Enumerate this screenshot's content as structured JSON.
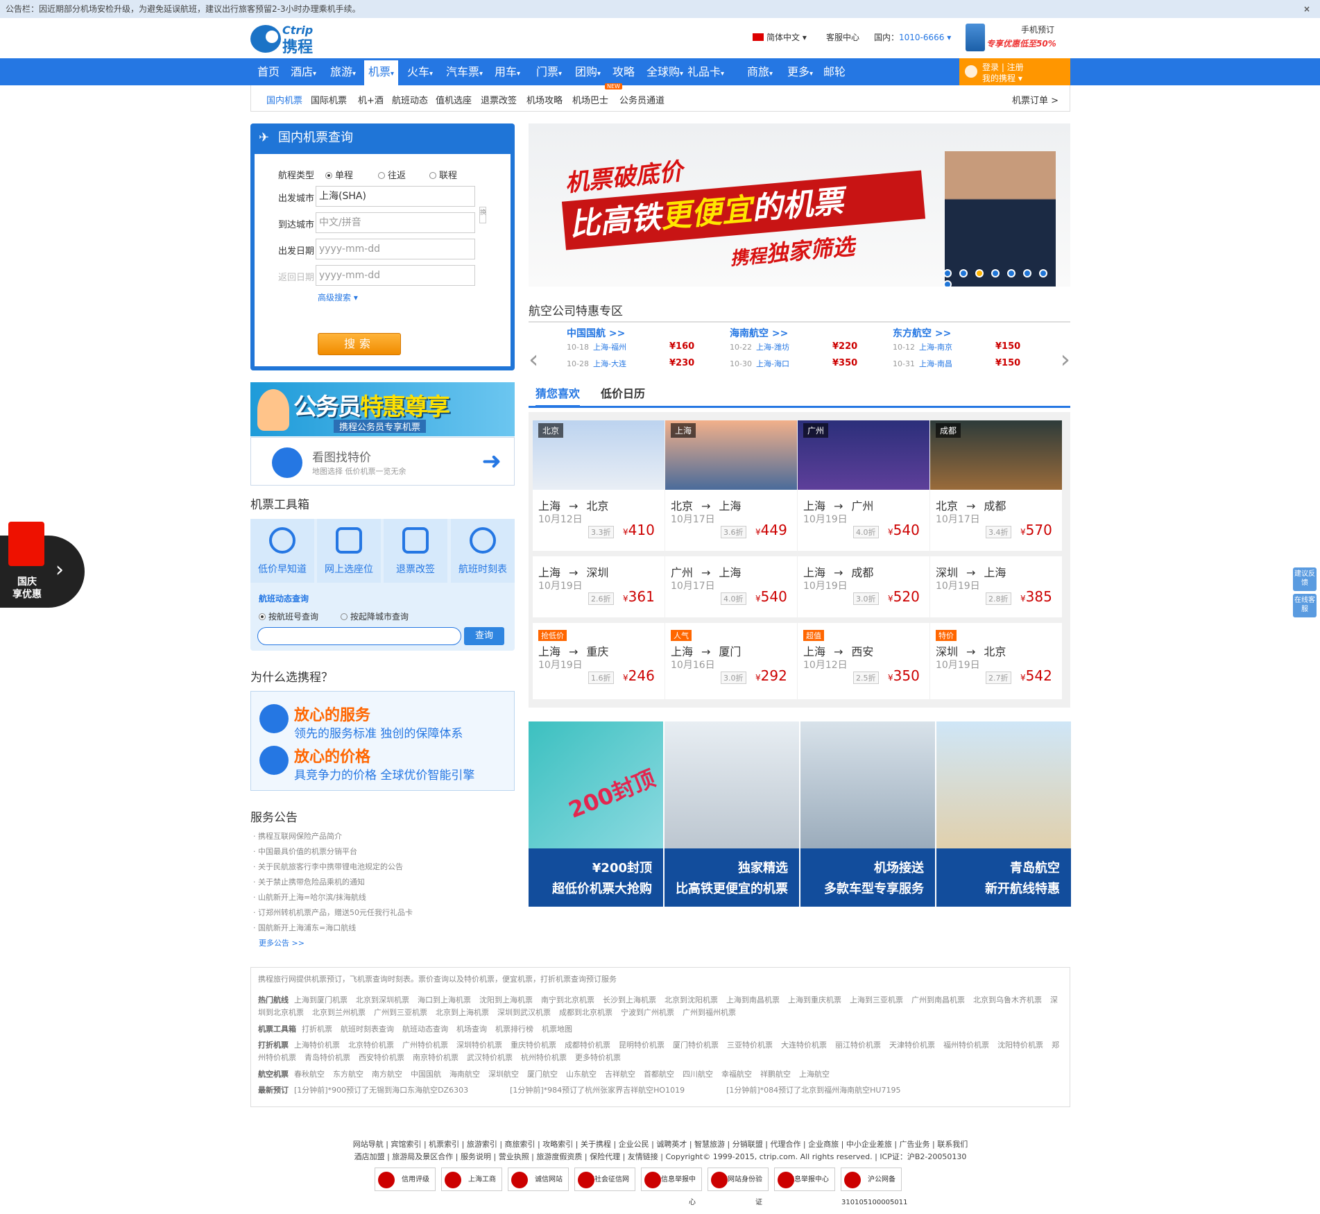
{
  "notice": {
    "text": "公告栏：因近期部分机场安检升级，为避免延误航班，建议出行旅客预留2-3小时办理乘机手续。",
    "close": "×"
  },
  "logo": {
    "en": "Ctrip",
    "cn": "携程"
  },
  "top": {
    "lang": "简体中文 ▾",
    "service": "客服中心",
    "phone_label": "国内：",
    "phone": "1010-6666 ▾",
    "mobile_title": "手机预订",
    "mobile_promo": "专享优惠低至50%"
  },
  "nav": {
    "items": [
      "首页",
      "酒店",
      "旅游",
      "机票",
      "火车",
      "汽车票",
      "用车",
      "门票",
      "团购",
      "攻略",
      "全球购",
      "礼品卡",
      "商旅",
      "更多",
      "邮轮"
    ],
    "carets": [
      "",
      "▾",
      "▾",
      "▾",
      "▾",
      "▾",
      "▾",
      "▾",
      "▾",
      "",
      "▾",
      "▾",
      "▾",
      "▾",
      ""
    ],
    "login": "登录 | 注册",
    "mytrip": "我的携程 ▾"
  },
  "subnav": {
    "items": [
      "国内机票",
      "国际机票",
      "机+酒",
      "航班动态",
      "值机选座",
      "退票改签",
      "机场攻略",
      "机场巴士",
      "公务员通道"
    ],
    "new_tag": "NEW",
    "orders": "机票订单 >"
  },
  "search": {
    "title": "国内机票查询",
    "type_label": "航程类型",
    "types": [
      "单程",
      "往返",
      "联程"
    ],
    "from_label": "出发城市",
    "from_value": "上海(SHA)",
    "to_label": "到达城市",
    "to_placeholder": "中文/拼音",
    "date_label": "出发日期",
    "date_placeholder": "yyyy-mm-dd",
    "return_label": "返回日期",
    "return_placeholder": "yyyy-mm-dd",
    "advanced": "高级搜索 ▾",
    "button": "搜索",
    "swap": "换"
  },
  "banner_civil": {
    "title1": "公务员",
    "title2": "特惠尊享",
    "sub": "携程公务员专享机票"
  },
  "mapfind": {
    "title": "看图找特价",
    "sub": "地图选择  低价机票一览无余"
  },
  "toolbox": {
    "title": "机票工具箱",
    "tools": [
      "低价早知道",
      "网上选座位",
      "退票改签",
      "航班时刻表"
    ],
    "flight_title": "航班动态查询",
    "opt1": "按航班号查询",
    "opt2": "按起降城市查询",
    "query": "查询"
  },
  "why": {
    "title": "为什么选携程？",
    "items": [
      {
        "h": "放心的服务",
        "d": "领先的服务标准 独创的保障体系"
      },
      {
        "h": "放心的价格",
        "d": "具竞争力的价格 全球优价智能引擎"
      }
    ]
  },
  "service": {
    "title": "服务公告",
    "items": [
      "· 携程互联网保险产品简介",
      "· 中国最具价值的机票分销平台",
      "· 关于民航旅客行李中携带锂电池规定的公告",
      "· 关于禁止携带危险品乘机的通知",
      "· 山航新开上海=哈尔滨/抹海航线",
      "· 订郑州转机机票产品，赠送50元任我行礼品卡",
      "· 国航新开上海浦东=海口航线"
    ],
    "more": "更多公告 >>"
  },
  "carousel": {
    "t1": "机票破底价",
    "t2a": "比高铁",
    "t2b": "更便宜",
    "t2c": "的机票",
    "t3a": "携程",
    "t3b": "独家筛选",
    "dots": 8,
    "active": 2
  },
  "airlines": {
    "title": "航空公司特惠专区",
    "list": [
      {
        "name": "中国国航 >>",
        "routes": [
          {
            "d": "10-18",
            "r": "上海-福州",
            "p": "¥160"
          },
          {
            "d": "10-28",
            "r": "上海-大连",
            "p": "¥230"
          }
        ]
      },
      {
        "name": "海南航空 >>",
        "routes": [
          {
            "d": "10-22",
            "r": "上海-潍坊",
            "p": "¥220"
          },
          {
            "d": "10-30",
            "r": "上海-海口",
            "p": "¥350"
          }
        ]
      },
      {
        "name": "东方航空 >>",
        "routes": [
          {
            "d": "10-12",
            "r": "上海-南京",
            "p": "¥150"
          },
          {
            "d": "10-31",
            "r": "上海-南昌",
            "p": "¥150"
          }
        ]
      }
    ]
  },
  "tabs": [
    "猜您喜欢",
    "低价日历"
  ],
  "cards": [
    {
      "city": "北京",
      "from": "上海",
      "to": "北京",
      "date": "10月12日",
      "disc": "3.3折",
      "price": "410",
      "tag": ""
    },
    {
      "city": "上海",
      "from": "北京",
      "to": "上海",
      "date": "10月17日",
      "disc": "3.6折",
      "price": "449",
      "tag": ""
    },
    {
      "city": "广州",
      "from": "上海",
      "to": "广州",
      "date": "10月19日",
      "disc": "4.0折",
      "price": "540",
      "tag": ""
    },
    {
      "city": "成都",
      "from": "北京",
      "to": "成都",
      "date": "10月17日",
      "disc": "3.4折",
      "price": "570",
      "tag": ""
    },
    {
      "city": "",
      "from": "上海",
      "to": "深圳",
      "date": "10月19日",
      "disc": "2.6折",
      "price": "361",
      "tag": ""
    },
    {
      "city": "",
      "from": "广州",
      "to": "上海",
      "date": "10月17日",
      "disc": "4.0折",
      "price": "540",
      "tag": ""
    },
    {
      "city": "",
      "from": "上海",
      "to": "成都",
      "date": "10月19日",
      "disc": "3.0折",
      "price": "520",
      "tag": ""
    },
    {
      "city": "",
      "from": "深圳",
      "to": "上海",
      "date": "10月19日",
      "disc": "2.8折",
      "price": "385",
      "tag": ""
    },
    {
      "city": "",
      "from": "上海",
      "to": "重庆",
      "date": "10月19日",
      "disc": "1.6折",
      "price": "246",
      "tag": "抢低价"
    },
    {
      "city": "",
      "from": "上海",
      "to": "厦门",
      "date": "10月16日",
      "disc": "3.0折",
      "price": "292",
      "tag": "人气"
    },
    {
      "city": "",
      "from": "上海",
      "to": "西安",
      "date": "10月12日",
      "disc": "2.5折",
      "price": "350",
      "tag": "超值"
    },
    {
      "city": "",
      "from": "深圳",
      "to": "北京",
      "date": "10月19日",
      "disc": "2.7折",
      "price": "542",
      "tag": "特价"
    }
  ],
  "arrow": "→",
  "promos": [
    {
      "l1": "¥200封顶",
      "l2": "超低价机票大抢购",
      "img": "200封顶"
    },
    {
      "l1": "独家精选",
      "l2": "比高铁更便宜的机票",
      "img": ""
    },
    {
      "l1": "机场接送",
      "l2": "多款车型专享服务",
      "img": ""
    },
    {
      "l1": "青岛航空",
      "l2": "新开航线特惠",
      "img": ""
    }
  ],
  "footer": {
    "intro": "携程旅行网提供机票预订，飞机票查询时刻表。票价查询以及特价机票，便宜机票，打折机票查询预订服务",
    "hot_label": "热门航线",
    "hot": [
      "上海到厦门机票",
      "北京到深圳机票",
      "海口到上海机票",
      "沈阳到上海机票",
      "南宁到北京机票",
      "长沙到上海机票",
      "北京到沈阳机票",
      "上海到南昌机票",
      "上海到重庆机票",
      "上海到三亚机票",
      "广州到南昌机票",
      "北京到乌鲁木齐机票",
      "深圳到北京机票",
      "北京到兰州机票",
      "广州到三亚机票",
      "北京到上海机票",
      "深圳到武汉机票",
      "成都到北京机票",
      "宁波到广州机票",
      "广州到福州机票"
    ],
    "tool_label": "机票工具箱",
    "tools": [
      "打折机票",
      "航班时刻表查询",
      "航班动态查询",
      "机场查询",
      "机票排行榜",
      "机票地图"
    ],
    "disc_label": "打折机票",
    "disc": [
      "上海特价机票",
      "北京特价机票",
      "广州特价机票",
      "深圳特价机票",
      "重庆特价机票",
      "成都特价机票",
      "昆明特价机票",
      "厦门特价机票",
      "三亚特价机票",
      "大连特价机票",
      "丽江特价机票",
      "天津特价机票",
      "福州特价机票",
      "沈阳特价机票",
      "郑州特价机票",
      "青岛特价机票",
      "西安特价机票",
      "南京特价机票",
      "武汉特价机票",
      "杭州特价机票",
      "更多特价机票"
    ],
    "air_label": "航空机票",
    "air": [
      "春秋航空",
      "东方航空",
      "南方航空",
      "中国国航",
      "海南航空",
      "深圳航空",
      "厦门航空",
      "山东航空",
      "吉祥航空",
      "首都航空",
      "四川航空",
      "幸福航空",
      "祥鹏航空",
      "上海航空"
    ],
    "latest_label": "最新预订",
    "latest": [
      "[1分钟前]*900预订了无锡到海口东海航空DZ6303",
      "[1分钟前]*984预订了杭州张家界吉祥航空HO1019",
      "[1分钟前]*084预订了北京到福州海南航空HU7195"
    ]
  },
  "bottom": {
    "links1": "网站导航 | 宾馆索引 | 机票索引 | 旅游索引 | 商旅索引 | 攻略索引 | 关于携程 | 企业公民 | 诚聘英才 | 智慧旅游 | 分销联盟 | 代理合作 | 企业商旅 | 中小企业差旅 | 广告业务 | 联系我们",
    "links2": "酒店加盟 | 旅游局及景区合作 | 服务说明 | 营业执照 | 旅游度假资质 | 保险代理 | 友情链接 | Copyright© 1999-2015, ctrip.com. All rights reserved. | ICP证：沪B2-20050130",
    "badges": [
      "信用评级",
      "上海工商",
      "诚信网站",
      "网络社会征信网",
      "违法信息举报中心",
      "可信网站身份验证",
      "信息举报中心",
      "沪公网备310105100005011"
    ]
  },
  "redenv": {
    "l1": "国庆",
    "l2": "享优惠"
  },
  "side": {
    "b1": "建议反馈",
    "b2": "在线客服"
  }
}
